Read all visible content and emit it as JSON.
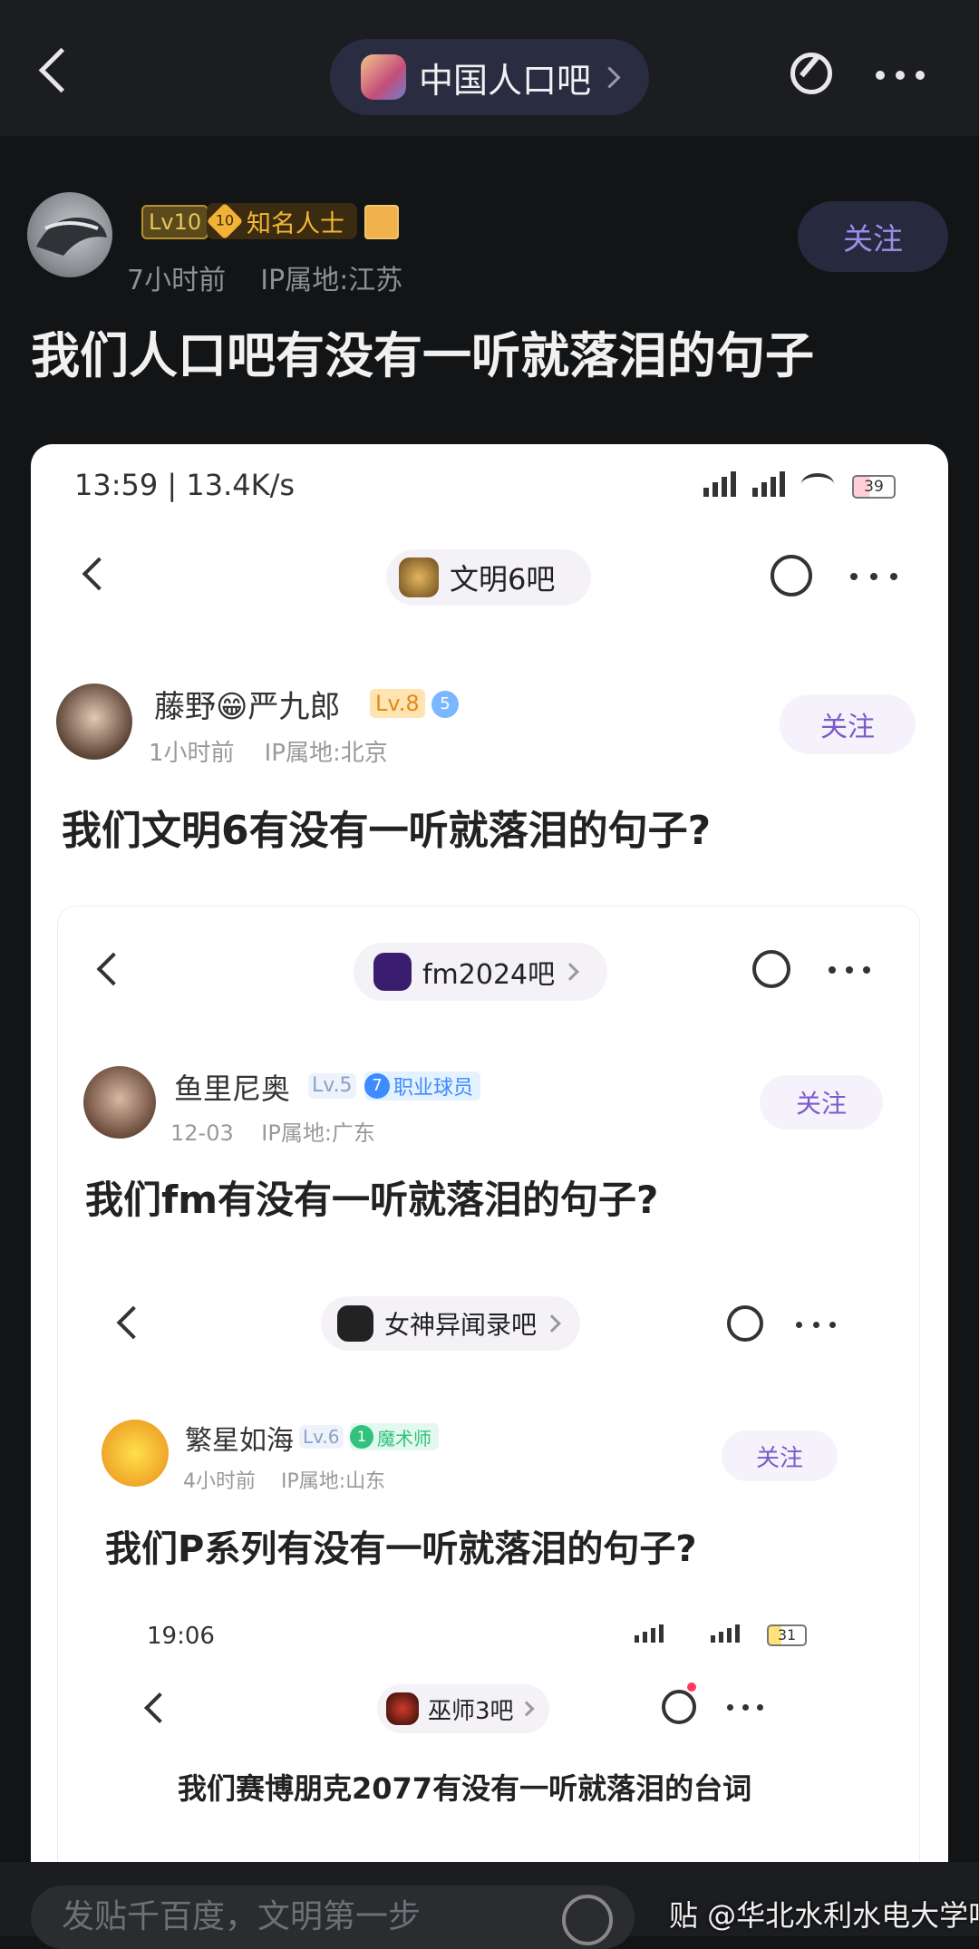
{
  "header": {
    "forum_name": "中国人口吧"
  },
  "post": {
    "level": "Lv10",
    "badge_number": "10",
    "badge_label": "知名人士",
    "time": "7小时前",
    "ip": "IP属地:江苏",
    "follow_label": "关注",
    "title": "我们人口吧有没有一听就落泪的句子"
  },
  "shot1": {
    "status_time": "13:59 | 13.4K/s",
    "battery": "39",
    "forum_name": "文明6吧",
    "user_name": "藤野😁严九郎",
    "level": "Lv.8",
    "badge_number": "5",
    "time": "1小时前",
    "ip": "IP属地:北京",
    "follow_label": "关注",
    "title": "我们文明6有没有一听就落泪的句子?"
  },
  "shot2": {
    "forum_name": "fm2024吧",
    "user_name": "鱼里尼奥",
    "level": "Lv.5",
    "badge_number": "7",
    "badge_label": "职业球员",
    "time": "12-03",
    "ip": "IP属地:广东",
    "follow_label": "关注",
    "title": "我们fm有没有一听就落泪的句子?"
  },
  "shot3": {
    "forum_name": "女神异闻录吧",
    "user_name": "繁星如海",
    "level": "Lv.6",
    "badge_number": "1",
    "badge_label": "魔术师",
    "time": "4小时前",
    "ip": "IP属地:山东",
    "follow_label": "关注",
    "title": "我们P系列有没有一听就落泪的句子?"
  },
  "shot4": {
    "status_time": "19:06",
    "battery": "31",
    "forum_name": "巫师3吧",
    "title": "我们赛博朋克2077有没有一听就落泪的台词"
  },
  "footer": {
    "reply_placeholder": "发贴千百度，文明第一步",
    "watermark": "贴 @华北水利水电大学吧"
  }
}
